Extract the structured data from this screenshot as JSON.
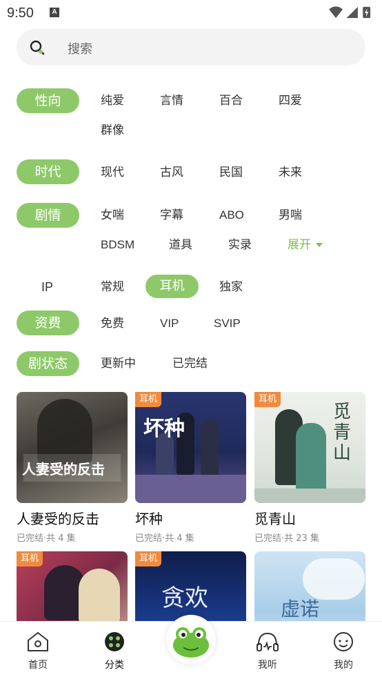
{
  "status": {
    "time": "9:50",
    "notif": "A"
  },
  "search": {
    "placeholder": "搜索"
  },
  "filters": {
    "orientation": {
      "label": "性向",
      "options": [
        "纯爱",
        "言情",
        "百合",
        "四爱",
        "群像"
      ]
    },
    "era": {
      "label": "时代",
      "options": [
        "现代",
        "古风",
        "民国",
        "未来"
      ]
    },
    "plot": {
      "label": "剧情",
      "options": [
        "女喘",
        "字幕",
        "ABO",
        "男喘",
        "BDSM",
        "道具",
        "实录"
      ],
      "expand": "展开"
    },
    "ip": {
      "label": "IP",
      "options": [
        "常规",
        "耳机",
        "独家"
      ],
      "selected": "耳机"
    },
    "fee": {
      "label": "资费",
      "options": [
        "免费",
        "VIP",
        "SVIP"
      ]
    },
    "status": {
      "label": "剧状态",
      "options": [
        "更新中",
        "已完结"
      ]
    }
  },
  "dramas": [
    {
      "title": "人妻受的反击",
      "meta": "已完结·共 4 集",
      "badge": "",
      "cover_text": "人妻受的反击"
    },
    {
      "title": "坏种",
      "meta": "已完结·共 4 集",
      "badge": "耳机",
      "cover_text": "坏种"
    },
    {
      "title": "觅青山",
      "meta": "已完结·共 23 集",
      "badge": "耳机",
      "cover_text": "觅青山"
    },
    {
      "title": "",
      "meta": "",
      "badge": "耳机",
      "cover_text": ""
    },
    {
      "title": "",
      "meta": "",
      "badge": "耳机",
      "cover_text": "贪欢"
    },
    {
      "title": "",
      "meta": "",
      "badge": "",
      "cover_text": "虚诺"
    }
  ],
  "tabbar": {
    "items": [
      "首页",
      "分类",
      "我听",
      "我的"
    ],
    "active": "分类"
  },
  "colors": {
    "accent": "#8ec969",
    "badge": "#f08a3c",
    "search_bg": "#f3f3f3"
  }
}
